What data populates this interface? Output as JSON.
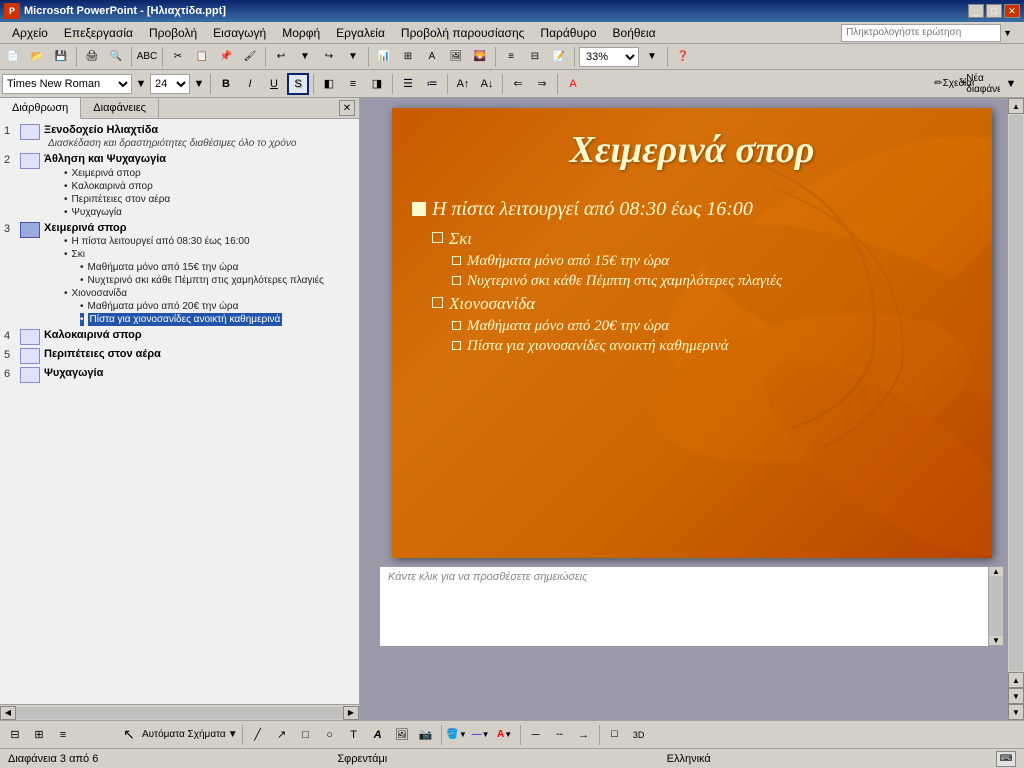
{
  "titleBar": {
    "title": "Microsoft PowerPoint - [Ηλιαχτίδα.ppt]",
    "appIcon": "PP"
  },
  "menuBar": {
    "items": [
      {
        "label": "Αρχείο",
        "id": "file"
      },
      {
        "label": "Επεξεργασία",
        "id": "edit"
      },
      {
        "label": "Προβολή",
        "id": "view"
      },
      {
        "label": "Εισαγωγή",
        "id": "insert"
      },
      {
        "label": "Μορφή",
        "id": "format"
      },
      {
        "label": "Εργαλεία",
        "id": "tools"
      },
      {
        "label": "Προβολή παρουσίασης",
        "id": "slideshow"
      },
      {
        "label": "Παράθυρο",
        "id": "window"
      },
      {
        "label": "Βοήθεια",
        "id": "help"
      }
    ],
    "searchPlaceholder": "Πληκτρολογήστε ερώτηση"
  },
  "toolbar": {
    "zoomValue": "33%"
  },
  "formatToolbar": {
    "fontName": "Times New Roman",
    "fontSize": "24",
    "schediasiLabel": "Σχεδίαση",
    "neaDiafaneiaLabel": "Νέα διαφάνεια"
  },
  "panel": {
    "tabs": [
      {
        "label": "Διάρθρωση",
        "active": true
      },
      {
        "label": "Διαφάνειες",
        "active": false
      }
    ]
  },
  "outline": {
    "items": [
      {
        "num": "1",
        "title": "Ξενοδοχείο Ηλιαχτίδα",
        "subtitle": "Διασκέδαση και δραστηριότητες διαθέσιμες όλο το χρόνο",
        "hasIcon": true,
        "bullets": []
      },
      {
        "num": "2",
        "title": "Άθληση και Ψυχαγωγία",
        "hasIcon": true,
        "bullets": [
          "Χειμερινά σπορ",
          "Καλοκαιρινά σπορ",
          "Περιπέτειες στον αέρα",
          "Ψυχαγωγία"
        ]
      },
      {
        "num": "3",
        "title": "Χειμερινά σπορ",
        "hasIcon": true,
        "selected": true,
        "bullets": [
          "Η πίστα λειτουργεί από 08:30 έως 16:00",
          "Σκι",
          "sub:Μαθήματα μόνο από 15€ την ώρα",
          "sub:Νυχτερινό σκι κάθε Πέμπτη στις χαμηλότερες πλαγιές",
          "Χιονοσανίδα",
          "sub:Μαθήματα μόνο από 20€ την ώρα",
          "sub:highlighted:Πίστα για χιονοσανίδες ανοικτή καθημερινά"
        ]
      },
      {
        "num": "4",
        "title": "Καλοκαιρινά σπορ",
        "hasIcon": true,
        "bullets": []
      },
      {
        "num": "5",
        "title": "Περιπέτειες στον αέρα",
        "hasIcon": true,
        "bullets": []
      },
      {
        "num": "6",
        "title": "Ψυχαγωγία",
        "hasIcon": true,
        "bullets": []
      }
    ]
  },
  "slide": {
    "title": "Χειμερινά σπορ",
    "mainBullet": "Η πίστα λειτουργεί από 08:30 έως 16:00",
    "sections": [
      {
        "title": "Σκι",
        "bullets": [
          "Μαθήματα μόνο από 15€ την ώρα",
          "Νυχτερινό σκι κάθε Πέμπτη στις χαμηλότερες πλαγιές"
        ]
      },
      {
        "title": "Χιονοσανίδα",
        "bullets": [
          "Μαθήματα μόνο από 20€ την ώρα",
          "Πίστα για χιονοσανίδες ανοικτή καθημερινά"
        ]
      }
    ]
  },
  "notes": {
    "placeholder": "Κάντε κλικ για να προσθέσετε σημειώσεις"
  },
  "statusBar": {
    "slideInfo": "Διαφάνεια 3 από 6",
    "theme": "Σφρεντάμι",
    "language": "Ελληνικά"
  }
}
